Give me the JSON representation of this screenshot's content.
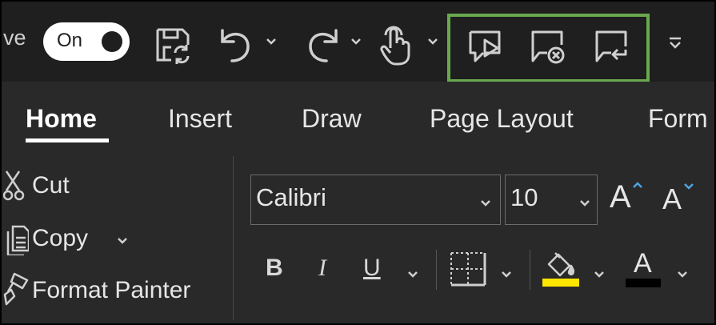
{
  "qat": {
    "autosave_label": "ve",
    "toggle_label": "On",
    "icons": [
      "save-sync-icon",
      "undo-icon",
      "redo-icon",
      "touch-mode-icon",
      "start-slideshow-icon",
      "end-review-icon",
      "reply-comment-icon",
      "customize-qat-icon"
    ]
  },
  "tabs": [
    {
      "label": "Home",
      "active": true
    },
    {
      "label": "Insert",
      "active": false
    },
    {
      "label": "Draw",
      "active": false
    },
    {
      "label": "Page Layout",
      "active": false
    },
    {
      "label": "Form",
      "active": false
    }
  ],
  "clipboard": {
    "cut_label": "Cut",
    "copy_label": "Copy",
    "format_painter_label": "Format Painter"
  },
  "font": {
    "font_name": "Calibri",
    "font_size": "10",
    "grow_glyph": "A",
    "shrink_glyph": "A",
    "bold_glyph": "B",
    "italic_glyph": "I",
    "underline_glyph": "U",
    "font_color_glyph": "A",
    "highlight_color": "#ffe600",
    "font_color": "#000000"
  },
  "colors": {
    "highlight_box": "#6aa84f",
    "background": "#292929"
  }
}
